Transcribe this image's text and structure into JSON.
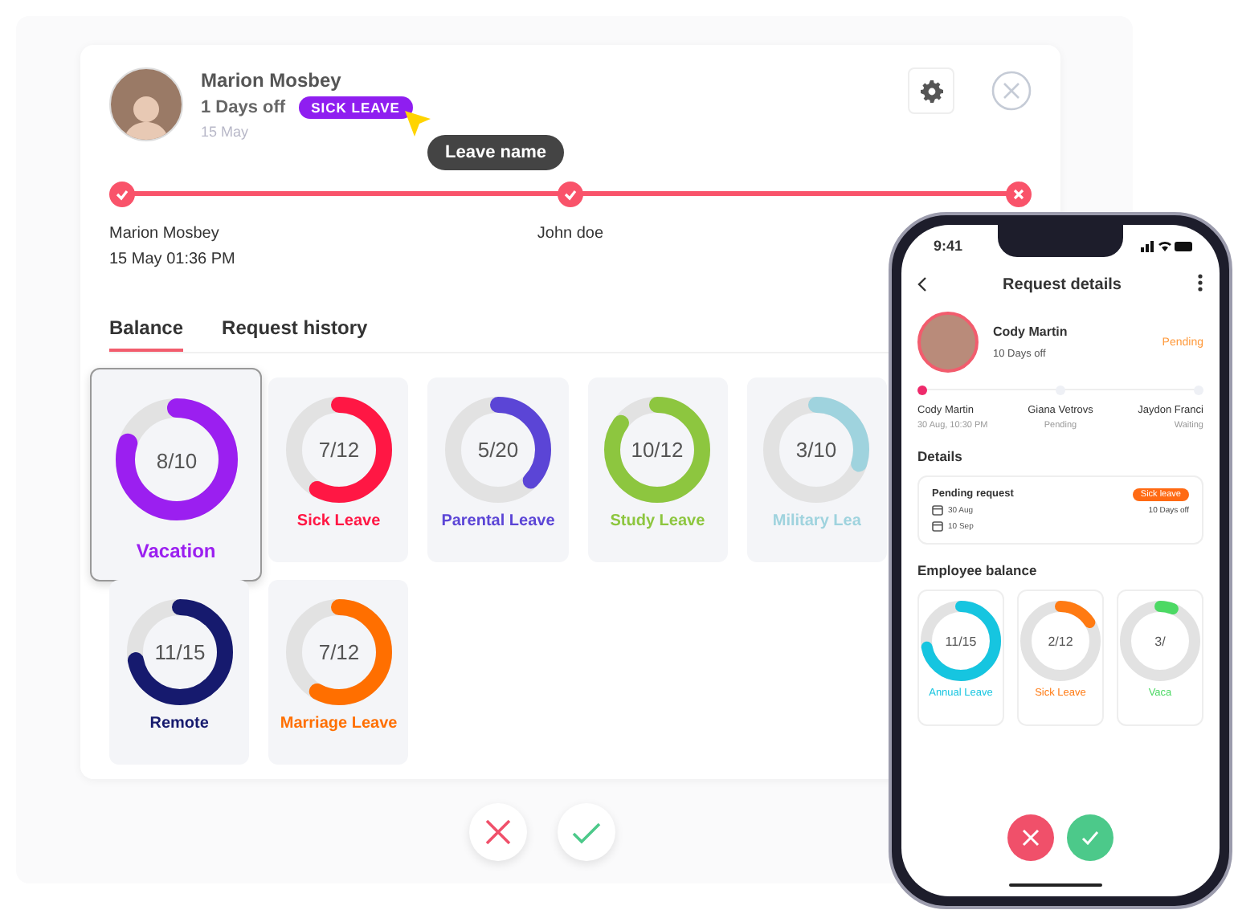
{
  "request": {
    "employee": "Marion Mosbey",
    "days_off": "1 Days off",
    "leave_type": "SICK LEAVE",
    "date": "15 May"
  },
  "tooltip": {
    "text": "Leave name"
  },
  "approval_steps": [
    {
      "name": "Marion Mosbey",
      "time": "15 May 01:36 PM",
      "rejected": false
    },
    {
      "name": "John doe",
      "rejected": false
    },
    {
      "rejected": true
    }
  ],
  "tabs": [
    {
      "label": "Balance",
      "selected": true
    },
    {
      "label": "Request history",
      "selected": false
    }
  ],
  "balances": [
    {
      "label": "Vacation",
      "reading": "8/10",
      "level": 0.8,
      "color": "#9b1ff0",
      "selected": true
    },
    {
      "label": "Sick Leave",
      "reading": "7/12",
      "level": 0.58,
      "color": "#ff1744",
      "selected": false
    },
    {
      "label": "Parental Leave",
      "reading": "5/20",
      "level": 0.37,
      "color": "#5b45d6",
      "selected": false
    },
    {
      "label": "Study Leave",
      "reading": "10/12",
      "level": 0.85,
      "color": "#8dc63f",
      "selected": false
    },
    {
      "label": "Military Lea",
      "reading": "3/10",
      "level": 0.3,
      "color": "#9fd3de",
      "selected": false
    },
    {
      "label": "Remote",
      "reading": "11/15",
      "level": 0.72,
      "color": "#161a6e",
      "selected": false
    },
    {
      "label": "Marriage Leave",
      "reading": "7/12",
      "level": 0.58,
      "color": "#ff6f00",
      "selected": false
    }
  ],
  "phone": {
    "time": "9:41",
    "title": "Request details",
    "employee": "Cody Martin",
    "days_off": "10 Days off",
    "status": "Pending",
    "steps": [
      {
        "name": "Cody Martin",
        "note": "30 Aug, 10:30 PM",
        "active": true
      },
      {
        "name": "Giana Vetrovs",
        "note": "Pending",
        "active": false
      },
      {
        "name": "Jaydon Franci",
        "note": "Waiting",
        "active": false
      }
    ],
    "details_heading": "Details",
    "details": {
      "title": "Pending request",
      "from": "30 Aug",
      "to": "10 Sep",
      "leave_type": "Sick leave",
      "days": "10 Days off"
    },
    "balance_heading": "Employee balance",
    "balances": [
      {
        "label": "Annual Leave",
        "reading": "11/15",
        "level": 0.72,
        "color": "#16c5e0"
      },
      {
        "label": "Sick Leave",
        "reading": "2/12",
        "level": 0.16,
        "color": "#ff7a12"
      },
      {
        "label": "Vaca",
        "reading": "3/",
        "level": 0.06,
        "color": "#4cd964"
      }
    ]
  }
}
